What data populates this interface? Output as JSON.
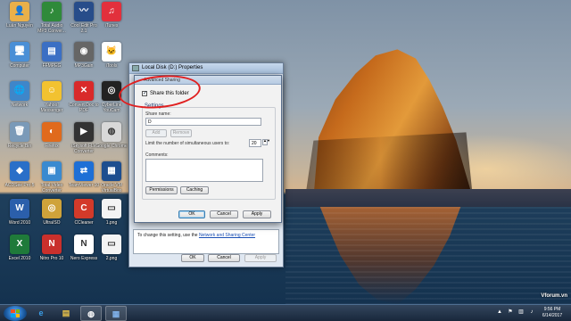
{
  "desktop_icons": [
    {
      "label": "Luân Nguyễn",
      "icon": "user-folder-icon",
      "color": "#e9b04a",
      "glyph": "👤"
    },
    {
      "label": "Total Audio MP3 Conver...",
      "icon": "music-note-icon",
      "color": "#2f8a3a",
      "glyph": "♪"
    },
    {
      "label": "Cool Edit Pro 2.1",
      "icon": "waveform-icon",
      "color": "#274d8a",
      "glyph": "〰"
    },
    {
      "label": "iTunes",
      "icon": "itunes-icon",
      "color": "#e2303c",
      "glyph": "♫"
    },
    {
      "label": "Computer",
      "icon": "computer-icon",
      "color": "#4a8fd6",
      "glyph": "🖥"
    },
    {
      "label": "FFMPEG",
      "icon": "ffmpeg-icon",
      "color": "#3b6fc4",
      "glyph": "▤"
    },
    {
      "label": "MP3Gain",
      "icon": "mp3gain-icon",
      "color": "#666666",
      "glyph": "◉"
    },
    {
      "label": "iTools",
      "icon": "itools-icon",
      "color": "#ffffff",
      "glyph": "🐱"
    },
    {
      "label": "Network",
      "icon": "network-icon",
      "color": "#3f86c9",
      "glyph": "🌐"
    },
    {
      "label": "Yahoo! Messenger",
      "icon": "yahoo-messenger-icon",
      "color": "#f2c230",
      "glyph": "☺"
    },
    {
      "label": "Convert Doc to PDF",
      "icon": "convert-doc-icon",
      "color": "#d92a2a",
      "glyph": "✕"
    },
    {
      "label": "CyberLink YouCam",
      "icon": "webcam-icon",
      "color": "#222222",
      "glyph": "◎"
    },
    {
      "label": "Recycle Bin",
      "icon": "recycle-bin-icon",
      "color": "#7a9ab8",
      "glyph": "🗑"
    },
    {
      "label": "Firefox",
      "icon": "firefox-icon",
      "color": "#e06a1c",
      "glyph": "◐"
    },
    {
      "label": "iSkysoft FLV Converter",
      "icon": "flv-converter-icon",
      "color": "#333333",
      "glyph": "▶"
    },
    {
      "label": "Google Chrome",
      "icon": "chrome-icon",
      "color": "#d8d8d8",
      "glyph": "◍"
    },
    {
      "label": "ACDSee Pro 5",
      "icon": "acdsee-icon",
      "color": "#2a6fc8",
      "glyph": "◆"
    },
    {
      "label": "Total Video Converter",
      "icon": "video-converter-icon",
      "color": "#3a8ad0",
      "glyph": "▣"
    },
    {
      "label": "TeamViewer 10",
      "icon": "teamviewer-icon",
      "color": "#1e6fd6",
      "glyph": "⇄"
    },
    {
      "label": "Oracle VM VirtualBox",
      "icon": "virtualbox-icon",
      "color": "#1d4e8f",
      "glyph": "▦"
    },
    {
      "label": "Word 2010",
      "icon": "word-icon",
      "color": "#2b5fab",
      "glyph": "W"
    },
    {
      "label": "UltraISO",
      "icon": "ultraiso-icon",
      "color": "#cfa33a",
      "glyph": "◎"
    },
    {
      "label": "CCleaner",
      "icon": "ccleaner-icon",
      "color": "#d33a2a",
      "glyph": "C"
    },
    {
      "label": "1.png",
      "icon": "png-file-icon",
      "color": "#f4f4f4",
      "glyph": "▭"
    },
    {
      "label": "Excel 2010",
      "icon": "excel-icon",
      "color": "#1f7a3a",
      "glyph": "X"
    },
    {
      "label": "Nitro Pro 10",
      "icon": "nitro-icon",
      "color": "#c9302c",
      "glyph": "N"
    },
    {
      "label": "Nero Express",
      "icon": "nero-icon",
      "color": "#ffffff",
      "glyph": "N"
    },
    {
      "label": "2.png",
      "icon": "png-file-icon",
      "color": "#f4f4f4",
      "glyph": "▭"
    }
  ],
  "back_dialog": {
    "title": "Local Disk (D:) Properties",
    "info_text": "To change this setting, use the",
    "link_text": "Network and Sharing Center",
    "ok": "OK",
    "cancel": "Cancel",
    "apply": "Apply"
  },
  "front_dialog": {
    "title": "Advanced Sharing",
    "share_checkbox_label": "Share this folder",
    "share_checked": true,
    "settings_label": "Settings",
    "share_name_label": "Share name:",
    "share_name_value": "D",
    "add": "Add",
    "remove": "Remove",
    "limit_label": "Limit the number of simultaneous users to:",
    "limit_value": "20",
    "comments_label": "Comments:",
    "permissions": "Permissions",
    "caching": "Caching",
    "ok": "OK",
    "cancel": "Cancel",
    "apply": "Apply"
  },
  "taskbar": {
    "items": [
      {
        "name": "ie-icon",
        "glyph": "e",
        "color": "#3a9ee8"
      },
      {
        "name": "explorer-icon",
        "glyph": "▤",
        "color": "#e8c24a"
      },
      {
        "name": "chrome-icon",
        "glyph": "◍",
        "color": "#ffffff"
      },
      {
        "name": "virtualbox-icon",
        "glyph": "▦",
        "color": "#7fb0e8"
      }
    ],
    "time": "9:56 PM",
    "date": "6/14/2017"
  },
  "watermark": "Vforum.vn"
}
